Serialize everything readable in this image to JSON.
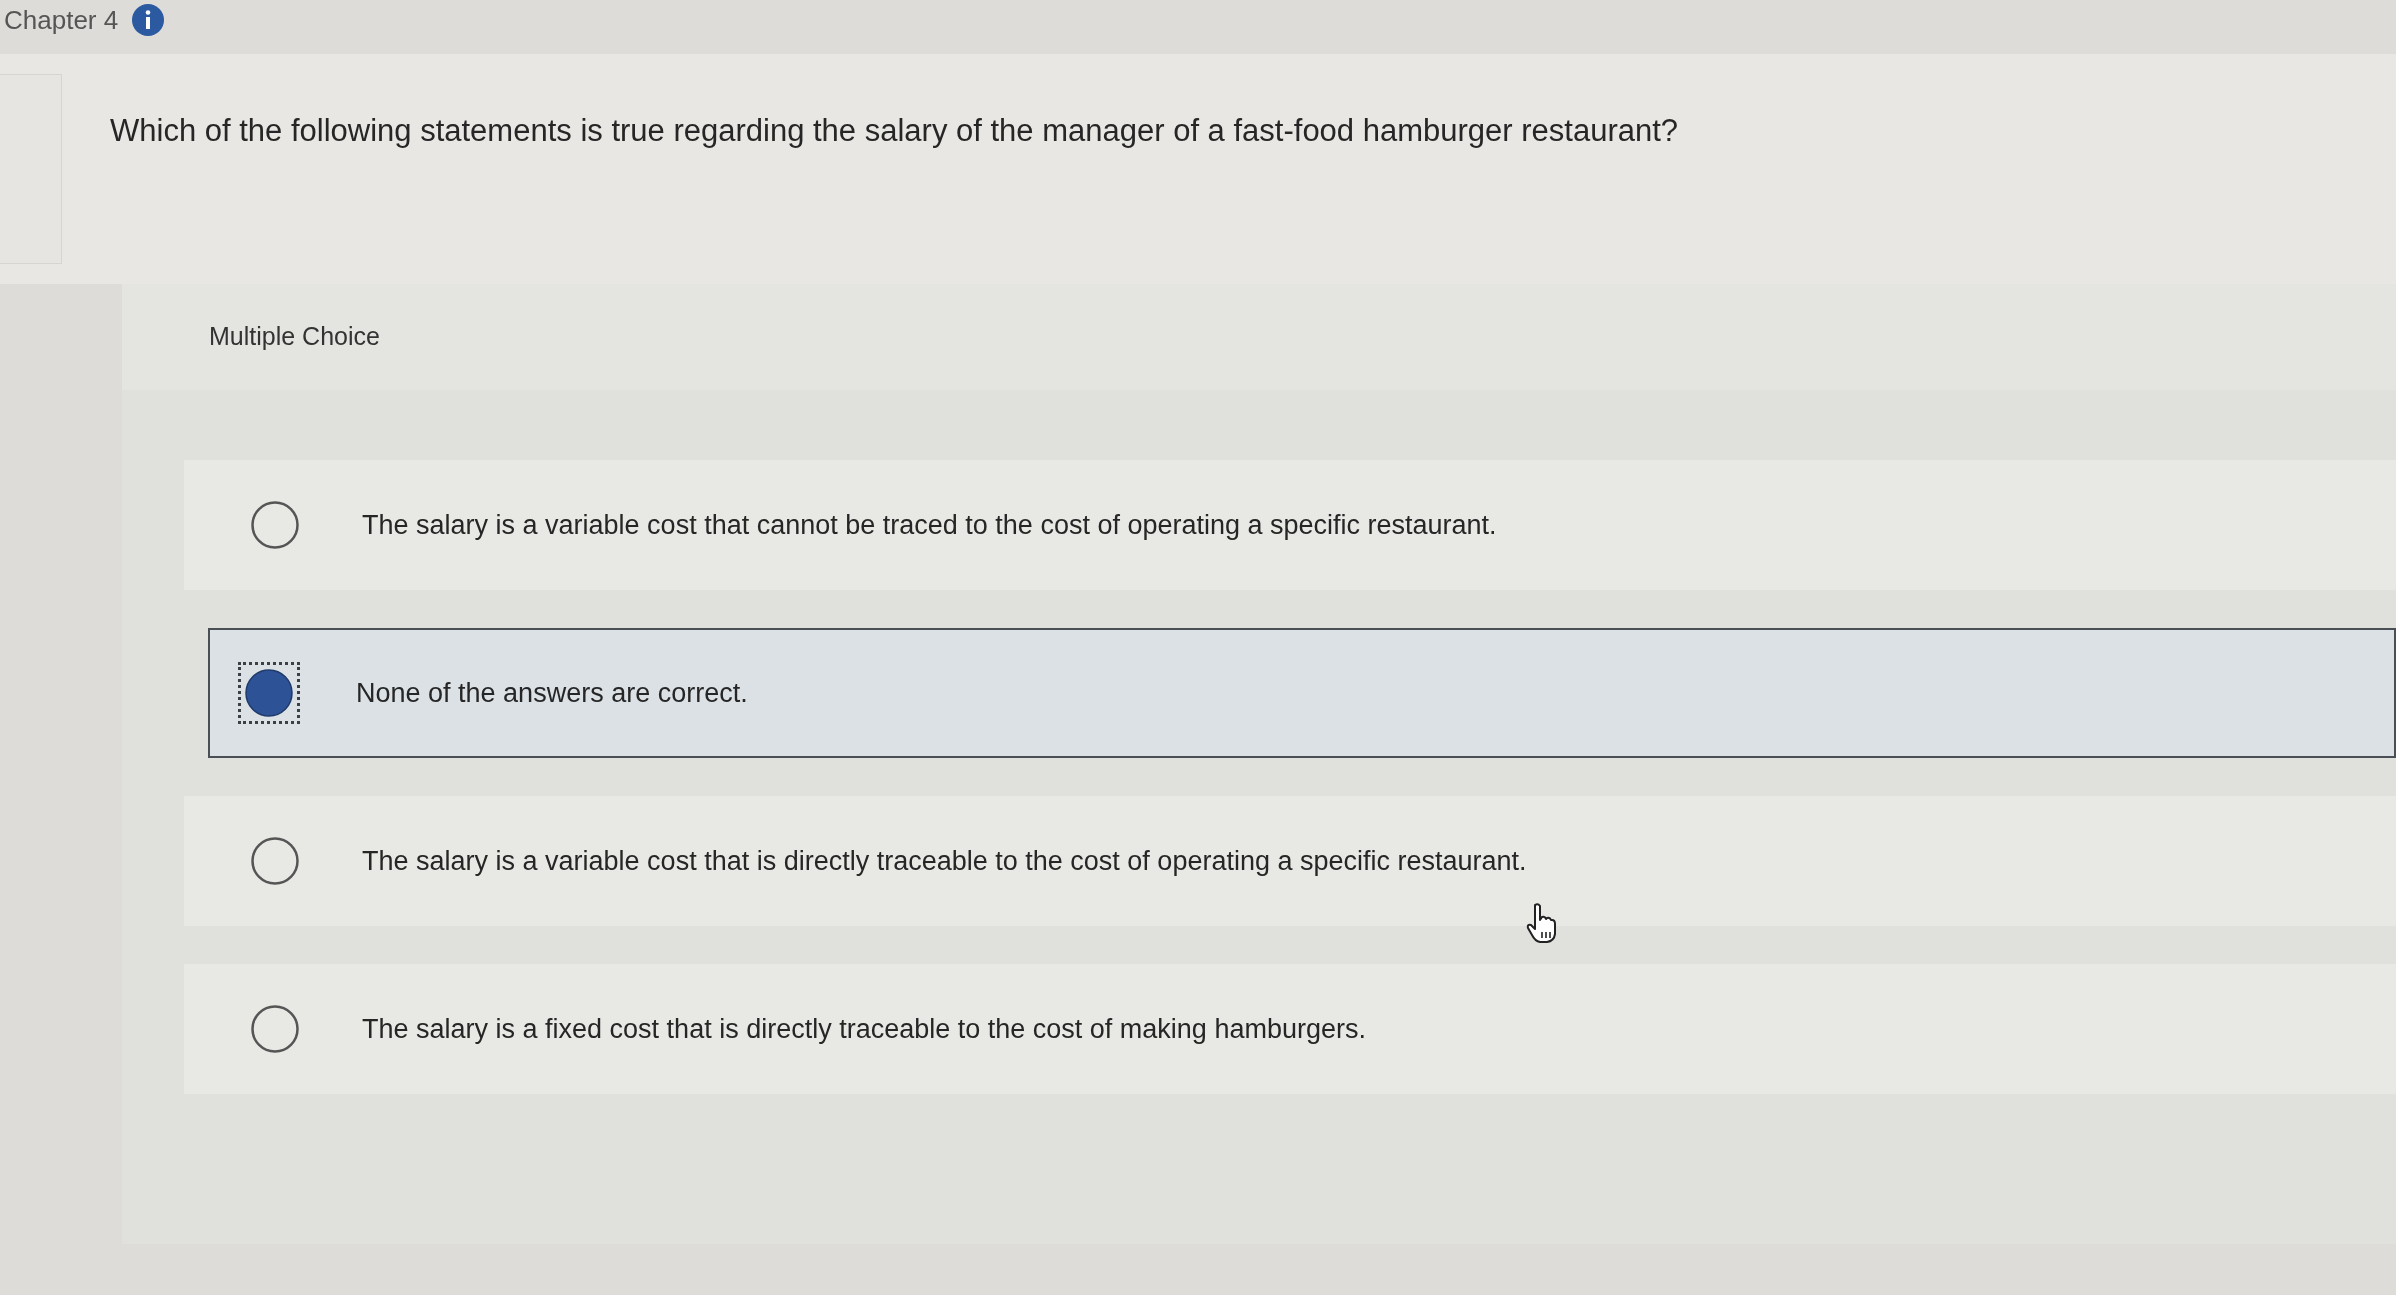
{
  "header": {
    "chapter": "Chapter 4"
  },
  "question": {
    "text": "Which of the following statements is true regarding the salary of the manager of a fast-food hamburger restaurant?"
  },
  "answer_panel": {
    "type_label": "Multiple Choice",
    "options": [
      {
        "text": "The salary is a variable cost that cannot be traced to the cost of operating a specific restaurant.",
        "selected": false
      },
      {
        "text": "None of the answers are correct.",
        "selected": true
      },
      {
        "text": "The salary is a variable cost that is directly traceable to the cost of operating a specific restaurant.",
        "selected": false
      },
      {
        "text": "The salary is a fixed cost that is directly traceable to the cost of making hamburgers.",
        "selected": false
      }
    ]
  }
}
